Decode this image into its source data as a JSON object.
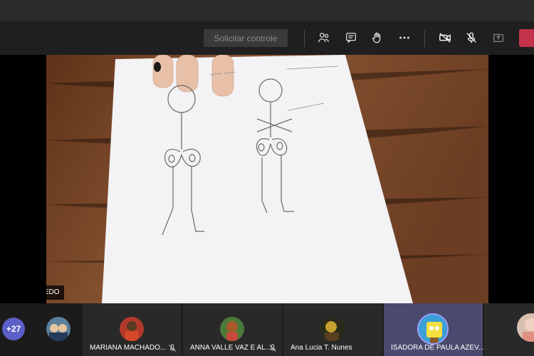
{
  "toolbar": {
    "request_control_label": "Solicitar controle",
    "icons": [
      "people-icon",
      "chat-icon",
      "raise-hand-icon",
      "more-options-icon",
      "camera-off-icon",
      "mic-off-icon",
      "share-tray-icon",
      "leave-icon"
    ]
  },
  "stage": {
    "presenter_name": "PAULA AZEVEDO"
  },
  "participants": {
    "overflow_count": "+27",
    "tiles": [
      {
        "name": "MARIANA MACHADO..."
      },
      {
        "name": "ANNA VALLE VAZ E AL..."
      },
      {
        "name": "Ana Lucia T. Nunes"
      },
      {
        "name": "ISADORA DE PAULA AZEV..."
      }
    ]
  },
  "colors": {
    "toolbar_bg": "#1f1f1f",
    "accent": "#5b5fc7",
    "leave": "#c4314b",
    "active_tile": "#4b4a6e"
  }
}
